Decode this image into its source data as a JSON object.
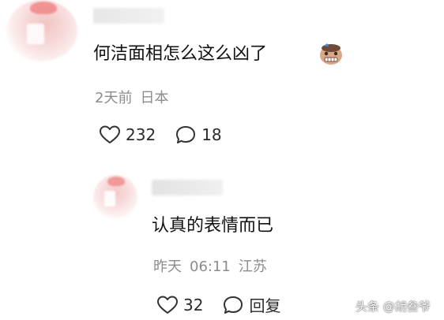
{
  "comment": {
    "text": "何洁面相怎么这么凶了",
    "emoji_icon": "grimace-face-sticker",
    "time": "2天前",
    "location": "日本",
    "likes": "232",
    "replies": "18"
  },
  "reply": {
    "text": "认真的表情而已",
    "time": "昨天",
    "clock": "06:11",
    "location": "江苏",
    "likes": "32",
    "reply_label": "回复"
  },
  "watermark": "头条 @胡叁爷",
  "colors": {
    "meta_gray": "#8c8c8c",
    "text": "#111111",
    "avatar_accent": "#ef7c7c"
  }
}
